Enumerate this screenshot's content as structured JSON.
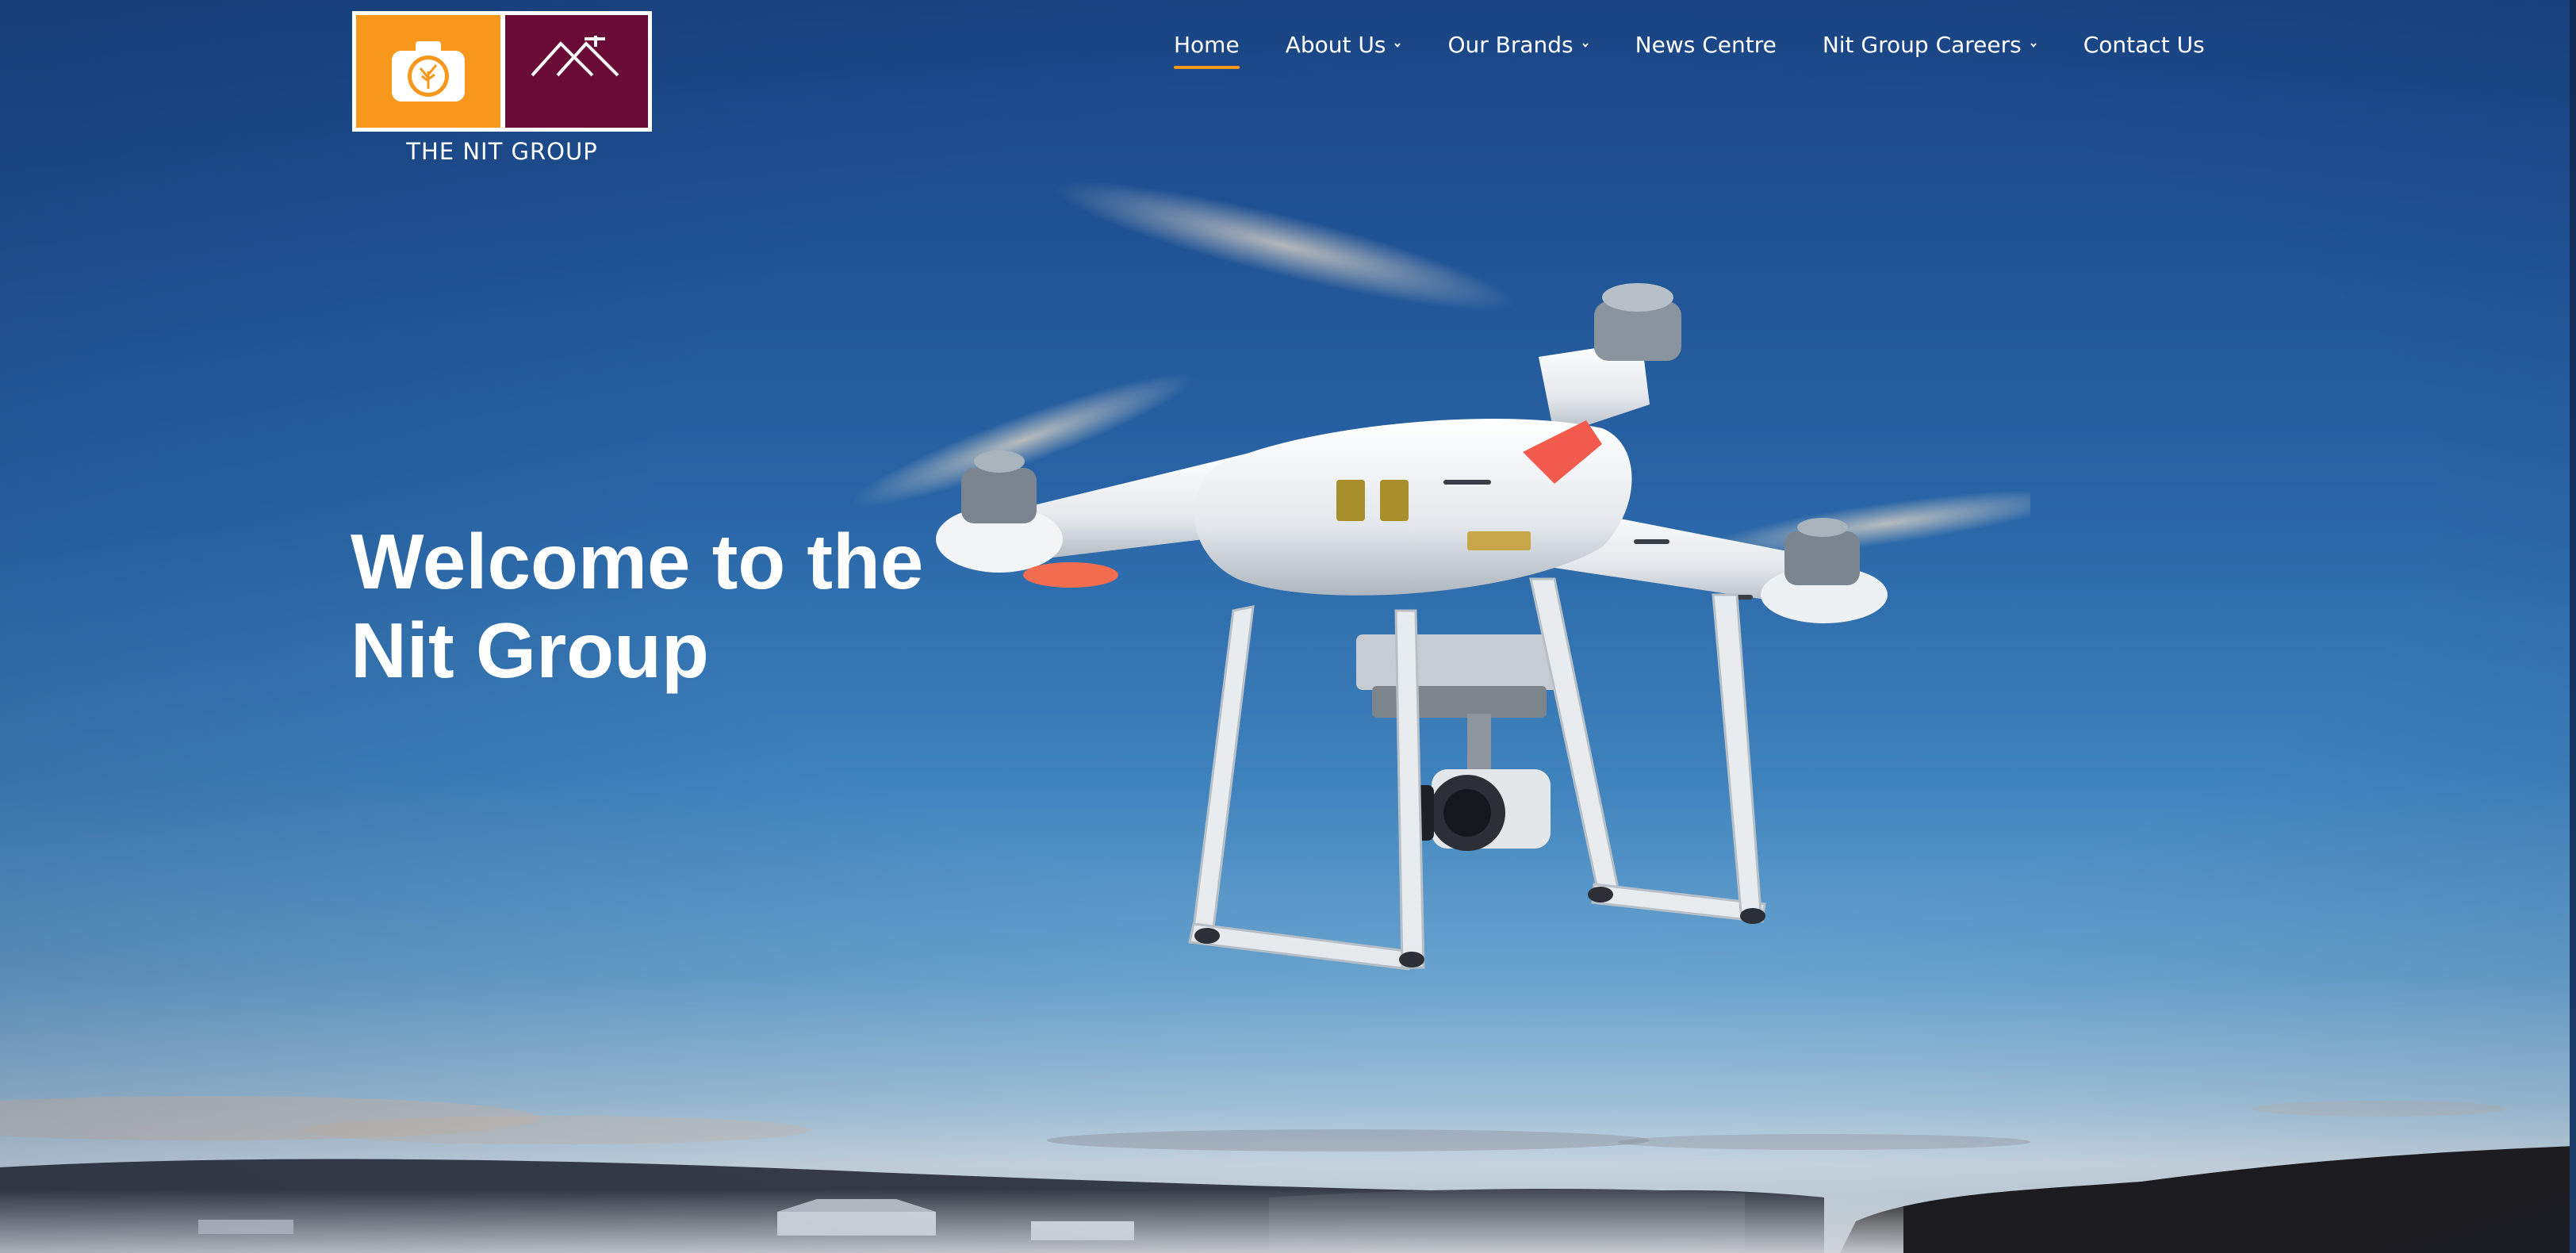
{
  "brand": {
    "name": "THE NIT GROUP",
    "colors": {
      "orange": "#f7981d",
      "maroon": "#6a0a37",
      "accent_underline": "#f7981d"
    },
    "left_icon": "camera-tree-icon",
    "right_icon": "house-roof-icon"
  },
  "nav": {
    "items": [
      {
        "label": "Home",
        "active": true,
        "has_dropdown": false
      },
      {
        "label": "About Us",
        "active": false,
        "has_dropdown": true
      },
      {
        "label": "Our Brands",
        "active": false,
        "has_dropdown": true
      },
      {
        "label": "News Centre",
        "active": false,
        "has_dropdown": false
      },
      {
        "label": "Nit Group Careers",
        "active": false,
        "has_dropdown": true
      },
      {
        "label": "Contact Us",
        "active": false,
        "has_dropdown": false
      }
    ]
  },
  "hero": {
    "headline_line1": "Welcome to the",
    "headline_line2": "Nit Group",
    "image_subject": "drone-photo"
  }
}
